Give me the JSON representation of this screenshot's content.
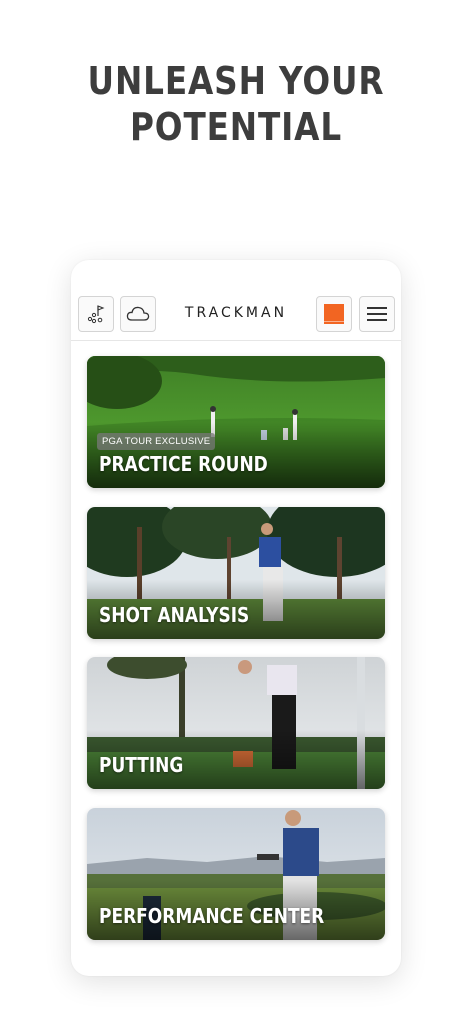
{
  "headline": {
    "line1": "UNLEASH YOUR",
    "line2": "POTENTIAL"
  },
  "topbar": {
    "brand": "TRACKMAN",
    "icons": [
      "course-icon",
      "cloud-icon",
      "trackman-unit-icon",
      "menu-icon"
    ],
    "accent_color": "#f26522"
  },
  "cards": [
    {
      "title": "PRACTICE ROUND",
      "badge": "PGA TOUR EXCLUSIVE"
    },
    {
      "title": "SHOT ANALYSIS"
    },
    {
      "title": "PUTTING"
    },
    {
      "title": "PERFORMANCE CENTER"
    }
  ]
}
